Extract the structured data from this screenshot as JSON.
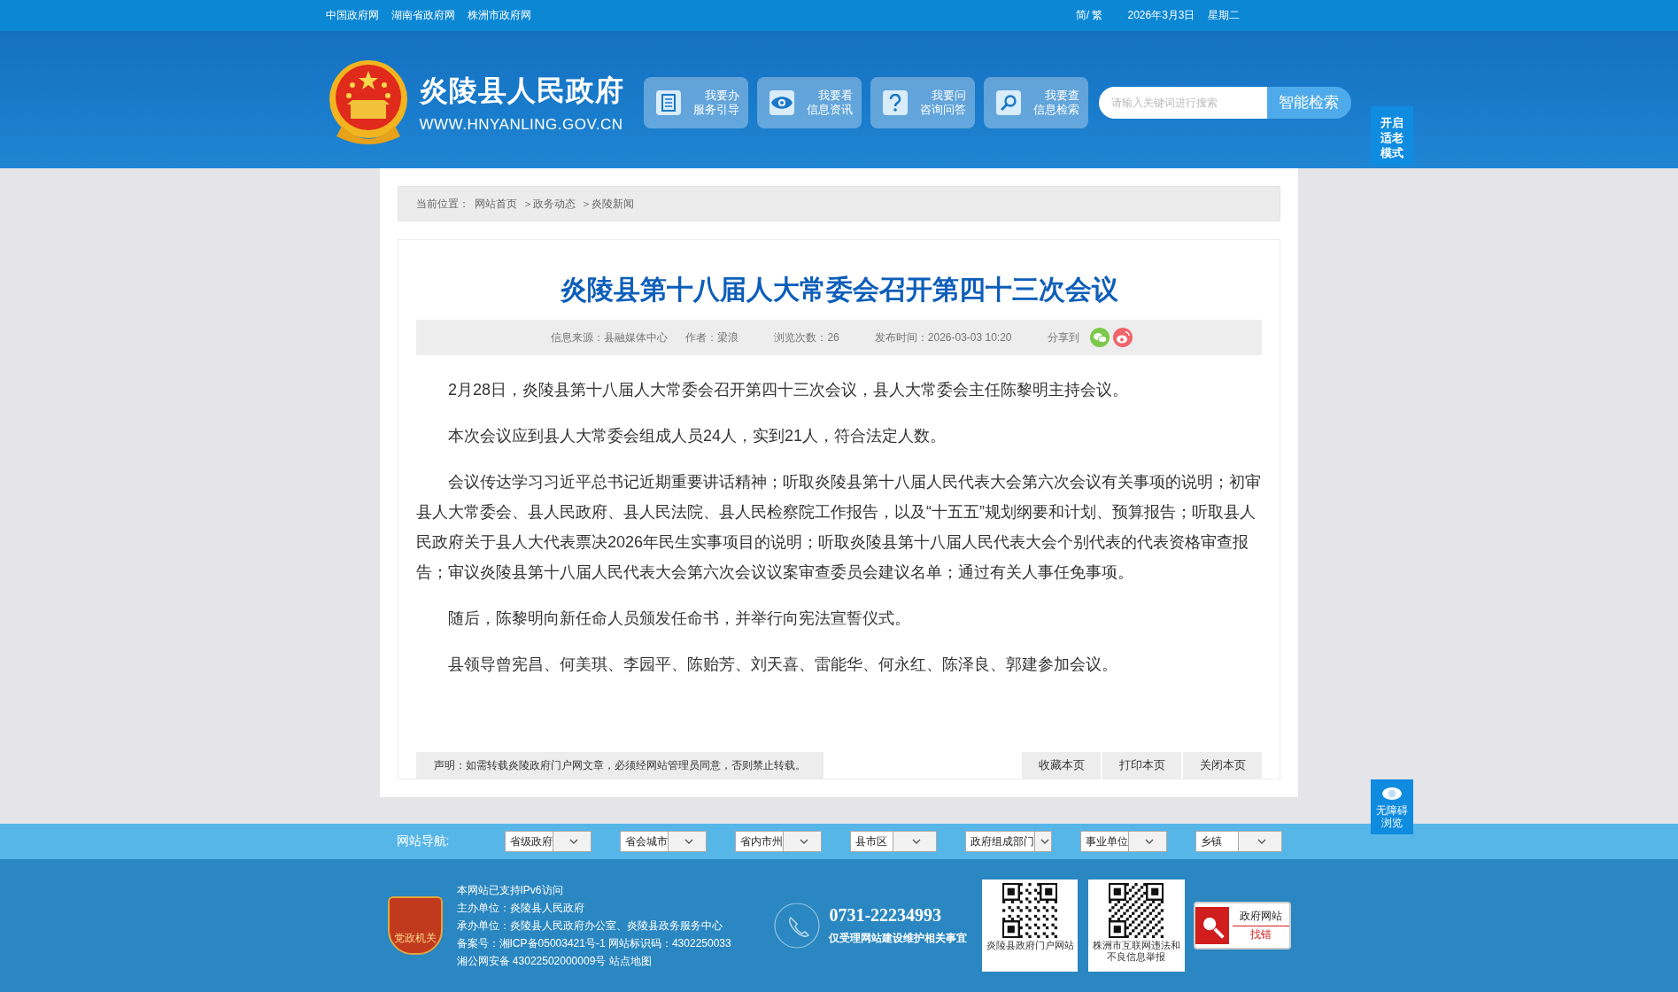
{
  "top_bar": {
    "links": [
      "中国政府网",
      "湖南省政府网",
      "株洲市政府网"
    ],
    "language_switch": "简/ 繁",
    "date": "2026年3月3日",
    "weekday": "星期二"
  },
  "header": {
    "site_name": "炎陵县人民政府",
    "site_url": "WWW.HNYANLING.GOV.CN",
    "nav": [
      {
        "kind": "document",
        "title": "我要办",
        "subtitle": "服务引导"
      },
      {
        "kind": "eye",
        "title": "我要看",
        "subtitle": "信息资讯"
      },
      {
        "kind": "question",
        "title": "我要问",
        "subtitle": "咨询问答"
      },
      {
        "kind": "search",
        "title": "我要查",
        "subtitle": "信息检索"
      }
    ],
    "search": {
      "placeholder": "请输入关键词进行搜索",
      "button": "智能检索"
    }
  },
  "elder_mode_button": "开启适老模式",
  "breadcrumb": {
    "label": "当前位置：",
    "items": [
      "网站首页",
      "＞政务动态",
      "＞炎陵新闻"
    ]
  },
  "article": {
    "title": "炎陵县第十八届人大常委会召开第四十三次会议",
    "meta": {
      "source": "信息来源：县融媒体中心",
      "author": "作者：梁浪",
      "views": "浏览次数：26",
      "published": "发布时间：2026-03-03 10:20",
      "share_label": "分享到"
    },
    "paragraphs": [
      "2月28日，炎陵县第十八届人大常委会召开第四十三次会议，县人大常委会主任陈黎明主持会议。",
      "本次会议应到县人大常委会组成人员24人，实到21人，符合法定人数。",
      "会议传达学习习近平总书记近期重要讲话精神；听取炎陵县第十八届人民代表大会第六次会议有关事项的说明；初审县人大常委会、县人民政府、县人民法院、县人民检察院工作报告，以及“十五五”规划纲要和计划、预算报告；听取县人民政府关于县人大代表票决2026年民生实事项目的说明；听取炎陵县第十八届人民代表大会个别代表的代表资格审查报告；审议炎陵县第十八届人民代表大会第六次会议议案审查委员会建议名单；通过有关人事任免事项。",
      "随后，陈黎明向新任命人员颁发任命书，并举行向宪法宣誓仪式。",
      "县领导曾宪昌、何美琪、李园平、陈贻芳、刘天喜、雷能华、何永红、陈泽良、郭建参加会议。"
    ],
    "notice": "声明：如需转载炎陵政府门户网文章，必须经网站管理员同意，否则禁止转载。",
    "actions": [
      "收藏本页",
      "打印本页",
      "关闭本页"
    ]
  },
  "accessibility_button": "无障碍浏览",
  "site_nav": {
    "label": "网站导航:",
    "selects": [
      "省级政府",
      "省会城市",
      "省内市州",
      "县市区",
      "政府组成部门",
      "事业单位",
      "乡镇"
    ]
  },
  "footer": {
    "badge": "党政机关",
    "lines": [
      "本网站已支持IPv6访问",
      "主办单位：炎陵县人民政府",
      "承办单位：炎陵县人民政府办公室、炎陵县政务服务中心",
      "备案号：湘ICP备05003421号-1 网站标识码：4302250033",
      "湘公网安备 43022502000009号 站点地图"
    ],
    "phone": "0731-22234993",
    "phone_note": "仅受理网站建设维护相关事宜",
    "qr_codes": [
      {
        "caption": "炎陵县政府门户网站"
      },
      {
        "caption": "株洲市互联网违法和不良信息举报"
      }
    ],
    "error_badge": {
      "title": "政府网站",
      "subtitle": "找错"
    }
  }
}
